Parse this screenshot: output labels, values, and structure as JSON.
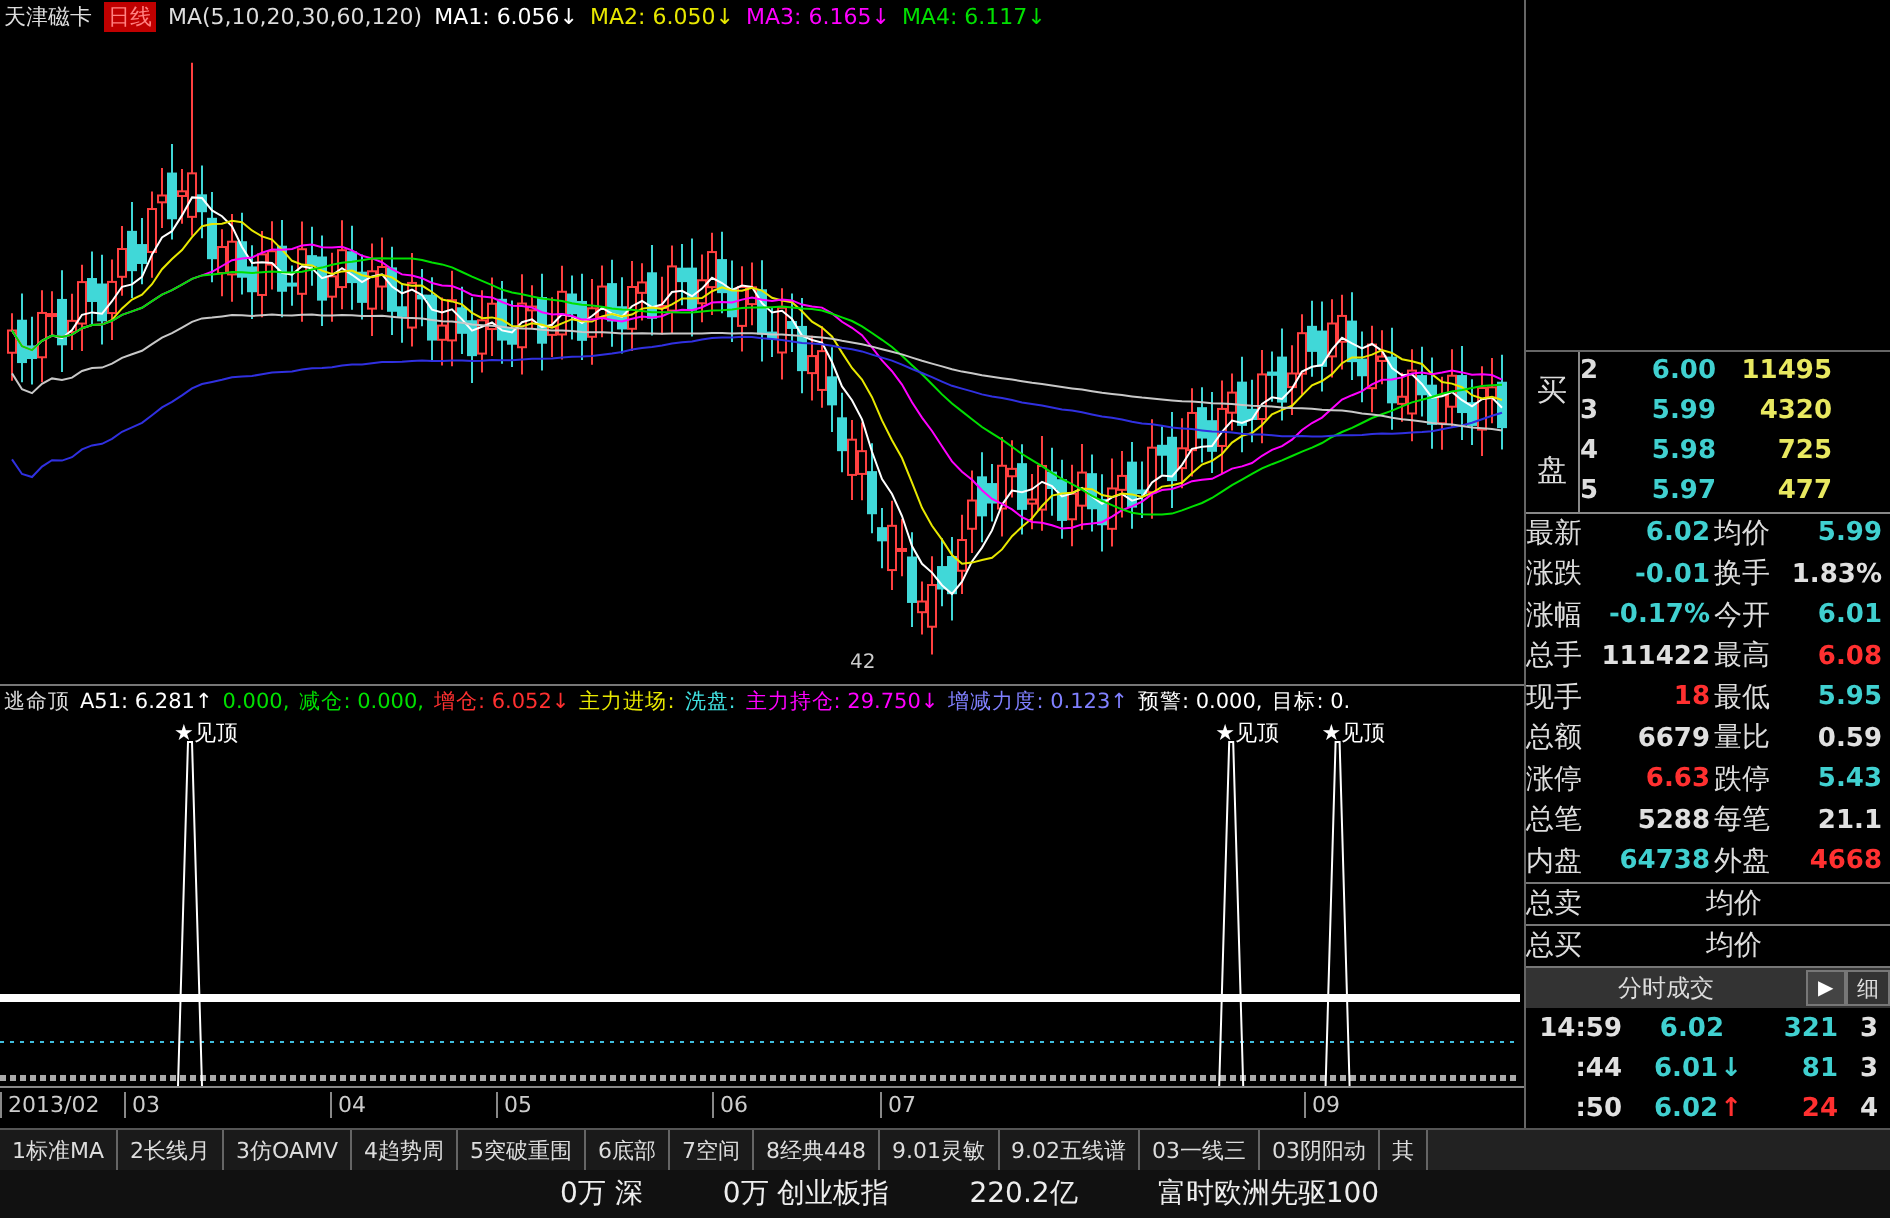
{
  "chart_header": {
    "stock": "天津磁卡",
    "period": "日线",
    "ma_params": "MA(5,10,20,30,60,120)",
    "ma_values": [
      {
        "label": "MA1:",
        "value": "6.056↓",
        "color": "#ffffff"
      },
      {
        "label": "MA2:",
        "value": "6.050↓",
        "color": "#e8e800"
      },
      {
        "label": "MA3:",
        "value": "6.165↓",
        "color": "#ff00ff"
      },
      {
        "label": "MA4:",
        "value": "6.117↓",
        "color": "#00e000"
      }
    ]
  },
  "zoom_label": "42",
  "indicator_header": {
    "name": "逃命顶",
    "fields": [
      {
        "text": "A51: 6.281↑",
        "color": "#ffffff"
      },
      {
        "text": "0.000,",
        "color": "#00e000"
      },
      {
        "text": "减仓: 0.000,",
        "color": "#00e000"
      },
      {
        "text": "增仓: 6.052↓",
        "color": "#ff3030"
      },
      {
        "text": "主力进场:",
        "color": "#e8e800"
      },
      {
        "text": "洗盘:",
        "color": "#40e0e0"
      },
      {
        "text": "主力持仓: 29.750↓",
        "color": "#ff00ff"
      },
      {
        "text": "增减力度: 0.123↑",
        "color": "#8080ff"
      },
      {
        "text": "预警: 0.000,",
        "color": "#ffffff"
      },
      {
        "text": "目标: 0.",
        "color": "#ffffff"
      }
    ]
  },
  "signals": [
    {
      "label": "★见顶"
    },
    {
      "label": "★见顶"
    },
    {
      "label": "★见顶"
    }
  ],
  "dates": [
    "2013/02",
    "03",
    "04",
    "05",
    "06",
    "07",
    "09"
  ],
  "order_book": {
    "side_labels": [
      "买",
      "盘"
    ],
    "rows": [
      {
        "index": "2",
        "price": "6.00",
        "volume": "11495"
      },
      {
        "index": "3",
        "price": "5.99",
        "volume": "4320"
      },
      {
        "index": "4",
        "price": "5.98",
        "volume": "725"
      },
      {
        "index": "5",
        "price": "5.97",
        "volume": "477"
      }
    ]
  },
  "quote": [
    {
      "label": "最新",
      "value": "6.02",
      "color": "#40d0d0"
    },
    {
      "label": "均价",
      "value": "5.99",
      "color": "#40d0d0"
    },
    {
      "label": "涨跌",
      "value": "-0.01",
      "color": "#40d0d0"
    },
    {
      "label": "换手",
      "value": "1.83%",
      "color": "#e0e0e0"
    },
    {
      "label": "涨幅",
      "value": "-0.17%",
      "color": "#40d0d0"
    },
    {
      "label": "今开",
      "value": "6.01",
      "color": "#40d0d0"
    },
    {
      "label": "总手",
      "value": "111422",
      "color": "#e0e0e0"
    },
    {
      "label": "最高",
      "value": "6.08",
      "color": "#ff3030"
    },
    {
      "label": "现手",
      "value": "18",
      "color": "#ff3030"
    },
    {
      "label": "最低",
      "value": "5.95",
      "color": "#40d0d0"
    },
    {
      "label": "总额",
      "value": "6679",
      "color": "#e0e0e0"
    },
    {
      "label": "量比",
      "value": "0.59",
      "color": "#e0e0e0"
    },
    {
      "label": "涨停",
      "value": "6.63",
      "color": "#ff3030"
    },
    {
      "label": "跌停",
      "value": "5.43",
      "color": "#40d0d0"
    },
    {
      "label": "总笔",
      "value": "5288",
      "color": "#e0e0e0"
    },
    {
      "label": "每笔",
      "value": "21.1",
      "color": "#e0e0e0"
    },
    {
      "label": "内盘",
      "value": "64738",
      "color": "#40d0d0"
    },
    {
      "label": "外盘",
      "value": "4668",
      "color": "#ff3030"
    }
  ],
  "totals": [
    {
      "label": "总卖",
      "label2": "均价"
    },
    {
      "label": "总买",
      "label2": "均价"
    }
  ],
  "ticks_header": {
    "title": "分时成交",
    "arrow": "▶",
    "detail": "细"
  },
  "ticks": [
    {
      "time": "14:59",
      "price": "6.02",
      "volume": "321",
      "color": "#40d0d0",
      "count": "3"
    },
    {
      "time": ":44",
      "price": "6.01",
      "arrow": "↓",
      "volume": "81",
      "color": "#40d0d0",
      "count": "3"
    },
    {
      "time": ":50",
      "price": "6.02",
      "arrow": "↑",
      "volume": "24",
      "color": "#ff3030",
      "count": "4"
    }
  ],
  "tabs": [
    {
      "label": "1标准MA",
      "selected": false
    },
    {
      "label": "2长线月",
      "selected": false
    },
    {
      "label": "3仿OAMV",
      "selected": false
    },
    {
      "label": "4趋势周",
      "selected": false
    },
    {
      "label": "5突破重围",
      "selected": false
    },
    {
      "label": "6底部",
      "selected": false
    },
    {
      "label": "7空间",
      "selected": false
    },
    {
      "label": "8经典448",
      "selected": false
    },
    {
      "label": "9.01灵敏",
      "selected": false
    },
    {
      "label": "9.02五线谱",
      "selected": false
    },
    {
      "label": "03一线三",
      "selected": false
    },
    {
      "label": "03阴阳动",
      "selected": false
    },
    {
      "label": "其",
      "selected": false
    }
  ],
  "status_bar": [
    "0万 深",
    "0万 创业板指",
    "220.2亿",
    "富时欧洲先驱100"
  ]
}
